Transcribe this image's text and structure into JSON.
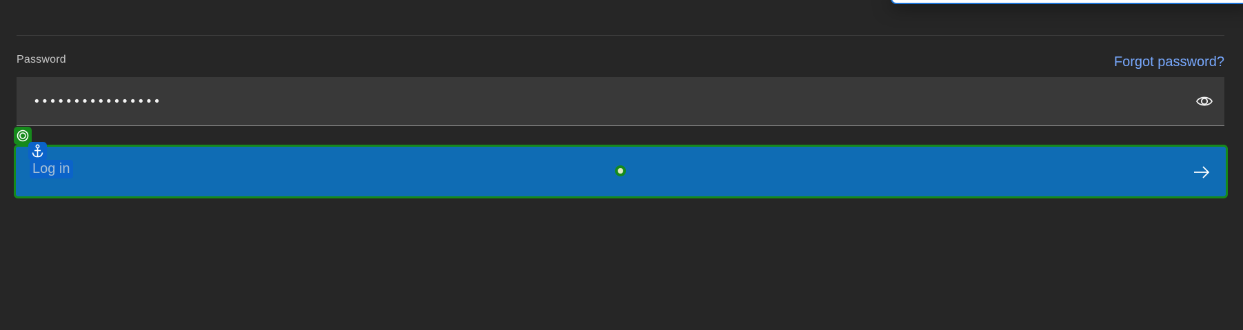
{
  "password_section": {
    "label": "Password",
    "forgot_link": "Forgot password?",
    "masked_value": "••••••••••••••••",
    "toggle_icon": "eye-icon"
  },
  "login_button": {
    "label": "Log in",
    "icon": "arrow-right-icon"
  },
  "overlay_markers": {
    "target_icon": "target-icon",
    "anchor_icon": "anchor-icon",
    "center_point": "center-dot"
  },
  "colors": {
    "background": "#262626",
    "field_bg": "#393939",
    "link": "#78a9ff",
    "primary_button": "#0f6cb4",
    "highlight_outline": "#168a1c",
    "marker_blue": "#0b63c9"
  }
}
